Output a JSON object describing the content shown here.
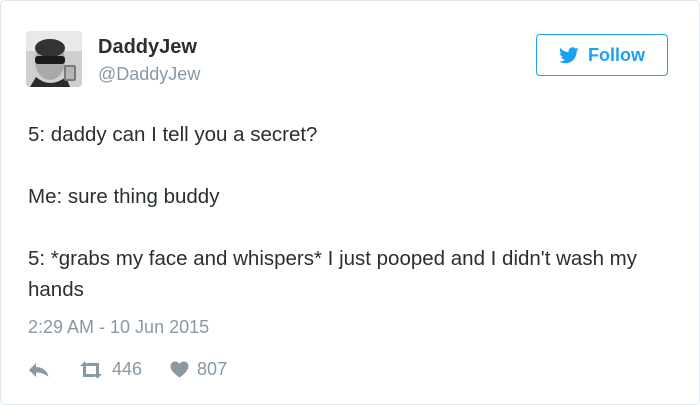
{
  "user": {
    "display_name": "DaddyJew",
    "handle": "@DaddyJew"
  },
  "follow_button": {
    "label": "Follow",
    "icon": "twitter-bird-icon"
  },
  "tweet": {
    "text": "5: daddy can I tell you a secret?\n\nMe: sure thing buddy\n\n5: *grabs my face and whispers* I just pooped and I didn't wash my hands",
    "timestamp": "2:29 AM - 10 Jun 2015"
  },
  "actions": {
    "reply_icon": "reply-arrow-icon",
    "retweet_icon": "retweet-icon",
    "retweet_count": "446",
    "like_icon": "heart-icon",
    "like_count": "807"
  },
  "colors": {
    "accent": "#1da1f2",
    "muted": "#8899a6",
    "text": "#292f33",
    "border": "#e1e8ed"
  }
}
